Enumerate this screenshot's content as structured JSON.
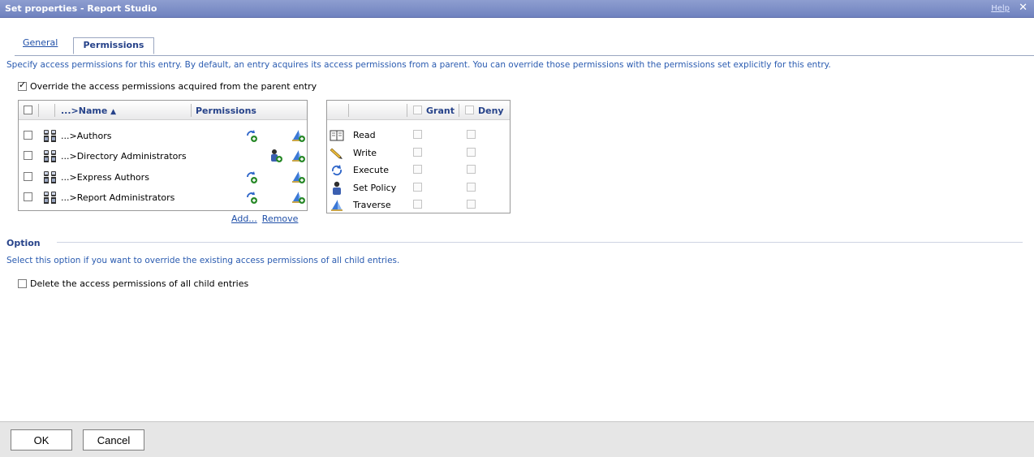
{
  "window": {
    "title": "Set properties - Report Studio",
    "help_label": "Help",
    "close_glyph": "✕"
  },
  "tabs": [
    {
      "label": "General",
      "active": false
    },
    {
      "label": "Permissions",
      "active": true
    }
  ],
  "description": "Specify access permissions for this entry. By default, an entry acquires its access permissions from a parent. You can override those permissions with the permissions set explicitly for this entry.",
  "override": {
    "label": "Override the access permissions acquired from the parent entry",
    "checked": true
  },
  "entries_table": {
    "name_header": "...>Name",
    "sort_glyph": "▲",
    "permissions_header": "Permissions",
    "rows": [
      {
        "name": "...>Authors",
        "perm1_icon": "execute-granted-icon",
        "perm2_icon": "traverse-granted-icon"
      },
      {
        "name": "...>Directory Administrators",
        "perm1_icon": "set-policy-granted-icon",
        "perm2_icon": "traverse-granted-icon"
      },
      {
        "name": "...>Express Authors",
        "perm1_icon": "execute-granted-icon",
        "perm2_icon": "traverse-granted-icon"
      },
      {
        "name": "...>Report Administrators",
        "perm1_icon": "execute-granted-icon",
        "perm2_icon": "traverse-granted-icon"
      }
    ],
    "add_label": "Add...",
    "remove_label": "Remove"
  },
  "permissions_table": {
    "grant_header": "Grant",
    "deny_header": "Deny",
    "rows": [
      {
        "label": "Read",
        "icon": "book-icon"
      },
      {
        "label": "Write",
        "icon": "pencil-icon"
      },
      {
        "label": "Execute",
        "icon": "execute-icon"
      },
      {
        "label": "Set Policy",
        "icon": "user-icon"
      },
      {
        "label": "Traverse",
        "icon": "traverse-icon"
      }
    ]
  },
  "option": {
    "title": "Option",
    "description": "Select this option if you want to override the existing access permissions of all child entries.",
    "delete_label": "Delete the access permissions of all child entries",
    "delete_checked": false
  },
  "buttons": {
    "ok": "OK",
    "cancel": "Cancel"
  },
  "colors": {
    "title_bar": "#7385c3",
    "link": "#1f4fa8",
    "header_text": "#27438a",
    "description_text": "#2a5bb0",
    "footer": "#e6e6e6"
  }
}
